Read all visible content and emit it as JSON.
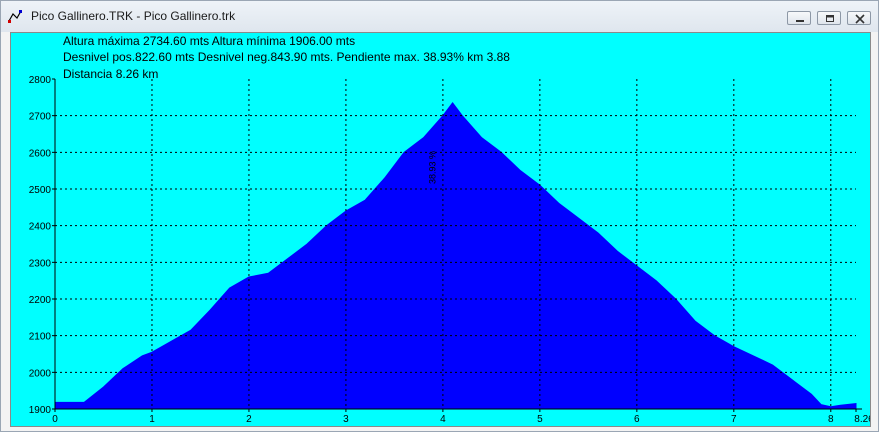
{
  "window": {
    "title": "Pico Gallinero.TRK - Pico Gallinero.trk",
    "icons": {
      "app": "chart-icon",
      "minimize": "minimize-icon",
      "maximize": "maximize-icon",
      "close": "close-icon"
    }
  },
  "info": {
    "line1": "Altura máxima 2734.60 mts Altura mínima 1906.00 mts",
    "line2": "Desnivel pos.822.60 mts  Desnivel neg.843.90 mts. Pendiente max. 38.93% km 3.88",
    "line3": "Distancia 8.26 km"
  },
  "colors": {
    "background": "#00ffff",
    "fill": "#0000ff",
    "grid": "#000000"
  },
  "chart_data": {
    "type": "area",
    "title": "",
    "xlabel": "",
    "ylabel": "",
    "xlim": [
      0,
      8.26
    ],
    "ylim": [
      1900,
      2800
    ],
    "grid": true,
    "x_ticks": [
      0,
      1,
      2,
      3,
      4,
      5,
      6,
      7,
      8,
      8.26
    ],
    "x_tick_labels": [
      "0",
      "1",
      "2",
      "3",
      "4",
      "5",
      "6",
      "7",
      "8",
      "8.26"
    ],
    "y_ticks": [
      1900,
      2000,
      2100,
      2200,
      2300,
      2400,
      2500,
      2600,
      2700,
      2800
    ],
    "y_tick_labels": [
      "1900",
      "2000",
      "2100",
      "2200",
      "2300",
      "2400",
      "2500",
      "2600",
      "2700",
      "2800"
    ],
    "annotation": {
      "text": "38.93 %",
      "x": 3.88
    },
    "series": [
      {
        "x": [
          0,
          0.3,
          0.5,
          0.7,
          0.9,
          1.0,
          1.2,
          1.4,
          1.6,
          1.8,
          2.0,
          2.2,
          2.4,
          2.6,
          2.8,
          3.0,
          3.2,
          3.4,
          3.6,
          3.8,
          4.0,
          4.1,
          4.2,
          4.4,
          4.6,
          4.8,
          5.0,
          5.2,
          5.4,
          5.6,
          5.8,
          6.0,
          6.2,
          6.4,
          6.6,
          6.8,
          7.0,
          7.2,
          7.4,
          7.6,
          7.8,
          7.9,
          8.0,
          8.1,
          8.26
        ],
        "values": [
          1918,
          1918,
          1960,
          2010,
          2045,
          2055,
          2085,
          2115,
          2170,
          2230,
          2260,
          2270,
          2310,
          2350,
          2400,
          2440,
          2470,
          2530,
          2600,
          2640,
          2700,
          2735,
          2700,
          2640,
          2600,
          2550,
          2510,
          2460,
          2420,
          2380,
          2330,
          2290,
          2250,
          2200,
          2140,
          2100,
          2070,
          2045,
          2020,
          1980,
          1940,
          1912,
          1906,
          1910,
          1915
        ]
      }
    ]
  }
}
